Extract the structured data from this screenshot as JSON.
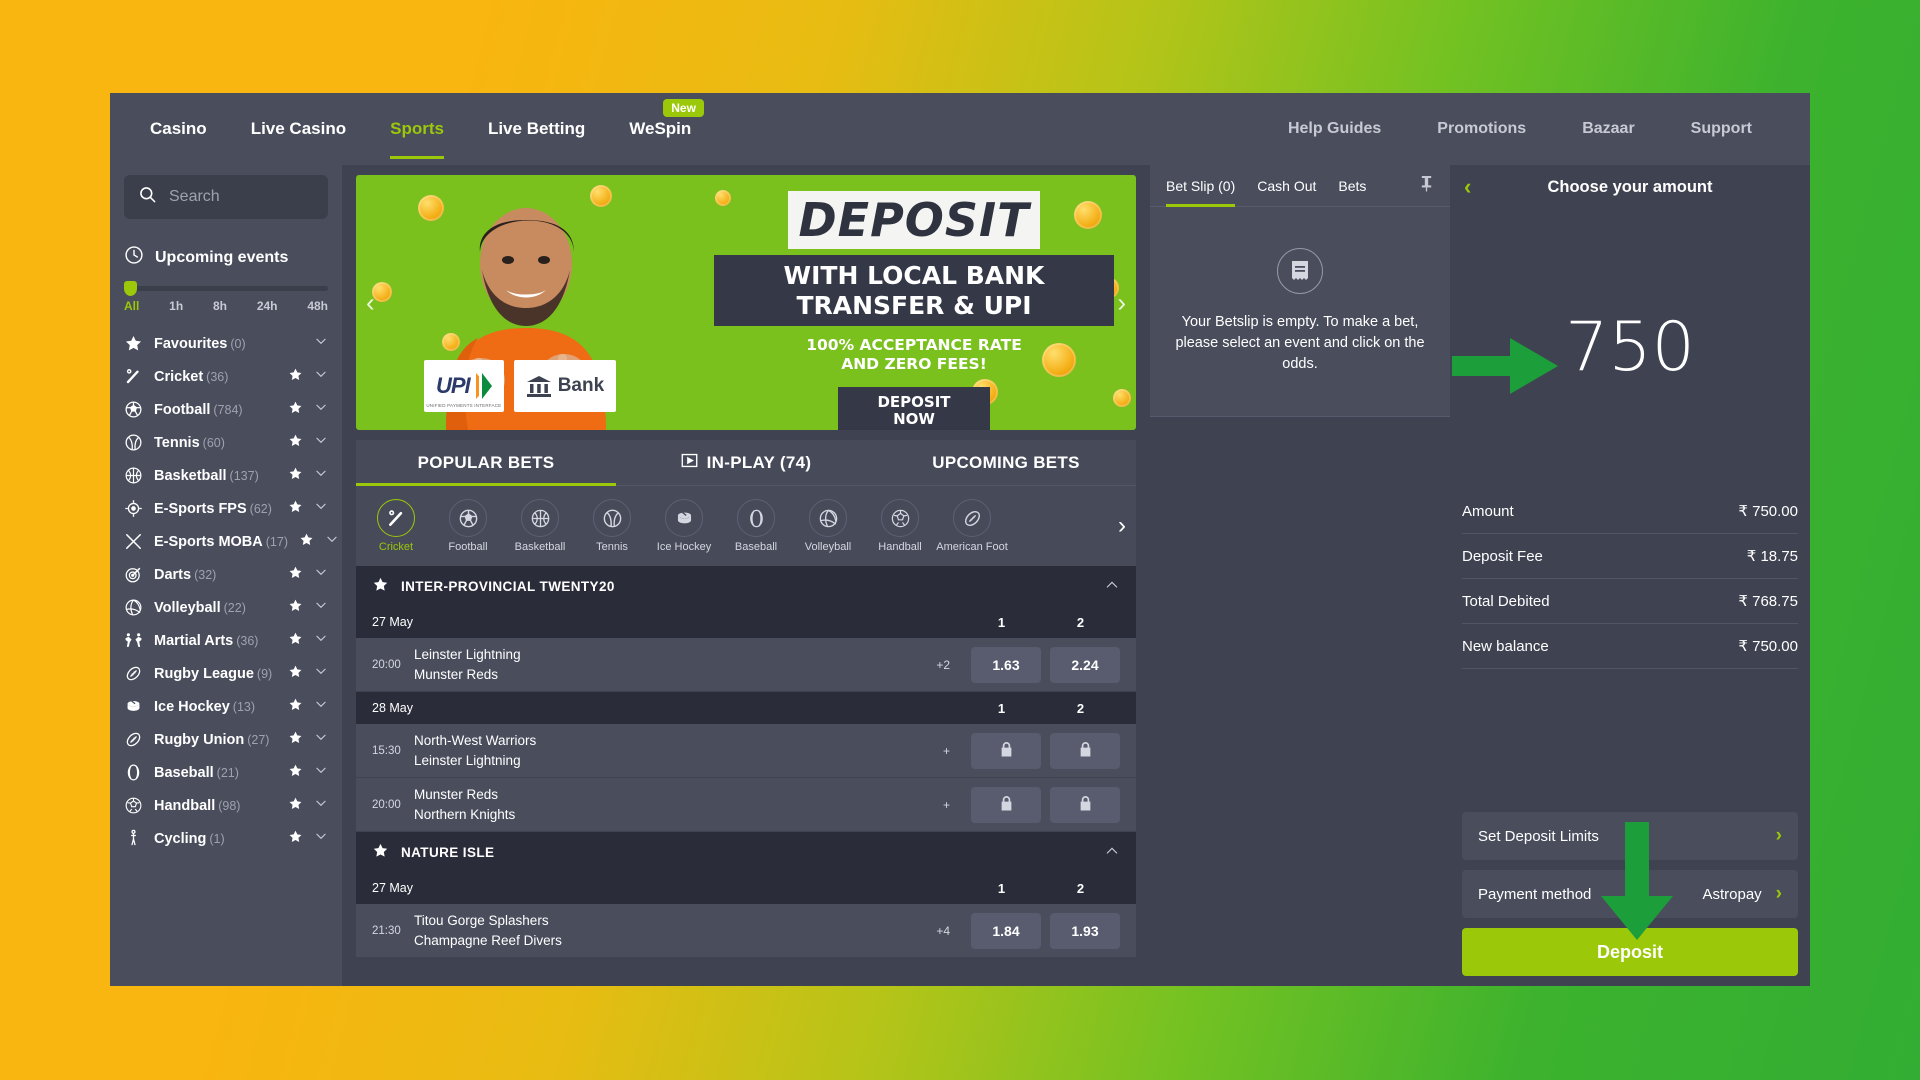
{
  "topnav": {
    "left_items": [
      {
        "label": "Casino",
        "active": false,
        "badge": null
      },
      {
        "label": "Live Casino",
        "active": false,
        "badge": null
      },
      {
        "label": "Sports",
        "active": true,
        "badge": null
      },
      {
        "label": "Live Betting",
        "active": false,
        "badge": null
      },
      {
        "label": "WeSpin",
        "active": false,
        "badge": "New"
      }
    ],
    "right_items": [
      {
        "label": "Help Guides"
      },
      {
        "label": "Promotions"
      },
      {
        "label": "Bazaar"
      },
      {
        "label": "Support"
      }
    ]
  },
  "sidebar": {
    "search_placeholder": "Search",
    "search_value": "",
    "upcoming_title": "Upcoming events",
    "time_filters": [
      "All",
      "1h",
      "8h",
      "24h",
      "48h"
    ],
    "time_filter_selected": "All",
    "sports": [
      {
        "name": "Favourites",
        "count": "(0)",
        "icon": "star-icon",
        "star": false
      },
      {
        "name": "Cricket",
        "count": "(36)",
        "icon": "cricket-icon",
        "star": true
      },
      {
        "name": "Football",
        "count": "(784)",
        "icon": "football-icon",
        "star": true
      },
      {
        "name": "Tennis",
        "count": "(60)",
        "icon": "tennis-icon",
        "star": true
      },
      {
        "name": "Basketball",
        "count": "(137)",
        "icon": "basketball-icon",
        "star": true
      },
      {
        "name": "E-Sports FPS",
        "count": "(62)",
        "icon": "esports-fps-icon",
        "star": true
      },
      {
        "name": "E-Sports MOBA",
        "count": "(17)",
        "icon": "esports-moba-icon",
        "star": true
      },
      {
        "name": "Darts",
        "count": "(32)",
        "icon": "darts-icon",
        "star": true
      },
      {
        "name": "Volleyball",
        "count": "(22)",
        "icon": "volleyball-icon",
        "star": true
      },
      {
        "name": "Martial Arts",
        "count": "(36)",
        "icon": "martial-arts-icon",
        "star": true
      },
      {
        "name": "Rugby League",
        "count": "(9)",
        "icon": "rugby-icon",
        "star": true
      },
      {
        "name": "Ice Hockey",
        "count": "(13)",
        "icon": "ice-hockey-icon",
        "star": true
      },
      {
        "name": "Rugby Union",
        "count": "(27)",
        "icon": "rugby-icon",
        "star": true
      },
      {
        "name": "Baseball",
        "count": "(21)",
        "icon": "baseball-icon",
        "star": true
      },
      {
        "name": "Handball",
        "count": "(98)",
        "icon": "handball-icon",
        "star": true
      },
      {
        "name": "Cycling",
        "count": "(1)",
        "icon": "cycling-icon",
        "star": true
      }
    ]
  },
  "banner": {
    "headline": "DEPOSIT",
    "subhead_line1": "WITH LOCAL BANK",
    "subhead_line2": "TRANSFER & UPI",
    "tagline_line1": "100% ACCEPTANCE RATE",
    "tagline_line2": "AND ZERO FEES!",
    "cta_line1": "DEPOSIT",
    "cta_line2": "NOW",
    "chip_upi": "UPI",
    "chip_upi_sub": "UNIFIED PAYMENTS INTERFACE",
    "chip_bank": "Bank",
    "prev_arrow": "‹",
    "next_arrow": "›"
  },
  "main_tabs": [
    {
      "label": "POPULAR BETS",
      "active": true,
      "icon": null
    },
    {
      "label": "IN-PLAY (74)",
      "active": false,
      "icon": "play-icon"
    },
    {
      "label": "UPCOMING BETS",
      "active": false,
      "icon": null
    }
  ],
  "sport_strip": {
    "items": [
      {
        "label": "Cricket",
        "icon": "cricket-icon",
        "active": true
      },
      {
        "label": "Football",
        "icon": "football-icon",
        "active": false
      },
      {
        "label": "Basketball",
        "icon": "basketball-icon",
        "active": false
      },
      {
        "label": "Tennis",
        "icon": "tennis-icon",
        "active": false
      },
      {
        "label": "Ice Hockey",
        "icon": "ice-hockey-icon",
        "active": false
      },
      {
        "label": "Baseball",
        "icon": "baseball-icon",
        "active": false
      },
      {
        "label": "Volleyball",
        "icon": "volleyball-icon",
        "active": false
      },
      {
        "label": "Handball",
        "icon": "handball-icon",
        "active": false
      },
      {
        "label": "American Foot",
        "icon": "american-football-icon",
        "active": false
      }
    ],
    "next_arrow": "›"
  },
  "leagues": [
    {
      "name": "INTER-PROVINCIAL TWENTY20",
      "groups": [
        {
          "date": "27 May",
          "col1": "1",
          "col2": "2",
          "matches": [
            {
              "time": "20:00",
              "home": "Leinster Lightning",
              "away": "Munster Reds",
              "extra": "+2",
              "odd1": "1.63",
              "odd2": "2.24",
              "locked": false
            }
          ]
        },
        {
          "date": "28 May",
          "col1": "1",
          "col2": "2",
          "matches": [
            {
              "time": "15:30",
              "home": "North-West Warriors",
              "away": "Leinster Lightning",
              "extra": "+",
              "odd1": "",
              "odd2": "",
              "locked": true
            },
            {
              "time": "20:00",
              "home": "Munster Reds",
              "away": "Northern Knights",
              "extra": "+",
              "odd1": "",
              "odd2": "",
              "locked": true
            }
          ]
        }
      ]
    },
    {
      "name": "NATURE ISLE",
      "groups": [
        {
          "date": "27 May",
          "col1": "1",
          "col2": "2",
          "matches": [
            {
              "time": "21:30",
              "home": "Titou Gorge Splashers",
              "away": "Champagne Reef Divers",
              "extra": "+4",
              "odd1": "1.84",
              "odd2": "1.93",
              "locked": false
            }
          ]
        }
      ]
    }
  ],
  "betslip": {
    "tabs": [
      {
        "label": "Bet Slip (0)",
        "active": true
      },
      {
        "label": "Cash Out",
        "active": false
      },
      {
        "label": "Bets",
        "active": false
      }
    ],
    "pin_icon": "pin-icon",
    "empty_icon": "receipt-icon",
    "empty_message": "Your Betslip is empty. To make a bet, please select an event and click on the odds."
  },
  "deposit": {
    "back_icon": "chevron-left-icon",
    "title": "Choose your amount",
    "amount_display": "750",
    "rows": [
      {
        "label": "Amount",
        "value": "₹ 750.00"
      },
      {
        "label": "Deposit Fee",
        "value": "₹ 18.75"
      },
      {
        "label": "Total Debited",
        "value": "₹ 768.75"
      },
      {
        "label": "New balance",
        "value": "₹ 750.00"
      }
    ],
    "set_limits_label": "Set Deposit Limits",
    "payment_method_label": "Payment method",
    "payment_method_value": "Astropay",
    "deposit_button": "Deposit",
    "accent_color": "#9bc809",
    "annotation_color": "#1c9e3a"
  }
}
